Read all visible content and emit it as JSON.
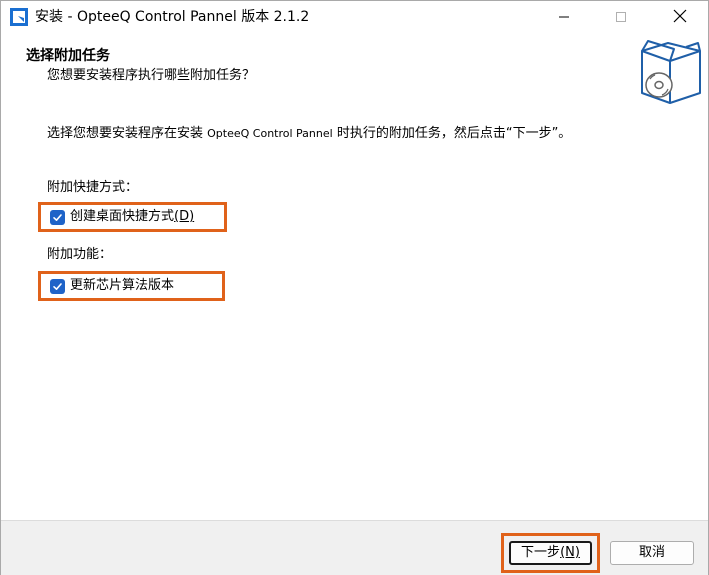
{
  "window": {
    "title": "安装 - OpteeQ Control Pannel 版本 2.1.2",
    "app_icon": "installer-app-icon",
    "controls": {
      "minimize_icon": "minimize-icon",
      "maximize_icon": "maximize-icon",
      "close_icon": "close-icon"
    }
  },
  "header": {
    "title": "选择附加任务",
    "subtitle": "您想要安装程序执行哪些附加任务？",
    "icon": "setup-box-disc-icon"
  },
  "body": {
    "description_pre": "选择您想要安装程序在安装 ",
    "product_name": "OpteeQ Control Pannel",
    "description_post": " 时执行的附加任务，然后点击“下一步”。",
    "groups": [
      {
        "label": "附加快捷方式：",
        "item_label": "创建桌面快捷方式",
        "item_accel": "(D)",
        "checked": true
      },
      {
        "label": "附加功能：",
        "item_label": "更新芯片算法版本",
        "item_accel": "",
        "checked": true
      }
    ]
  },
  "footer": {
    "next_label": "下一步",
    "next_accel": "(N)",
    "cancel_label": "取消"
  },
  "colors": {
    "checkbox": "#1e63c8",
    "highlight": "#e0621a"
  }
}
